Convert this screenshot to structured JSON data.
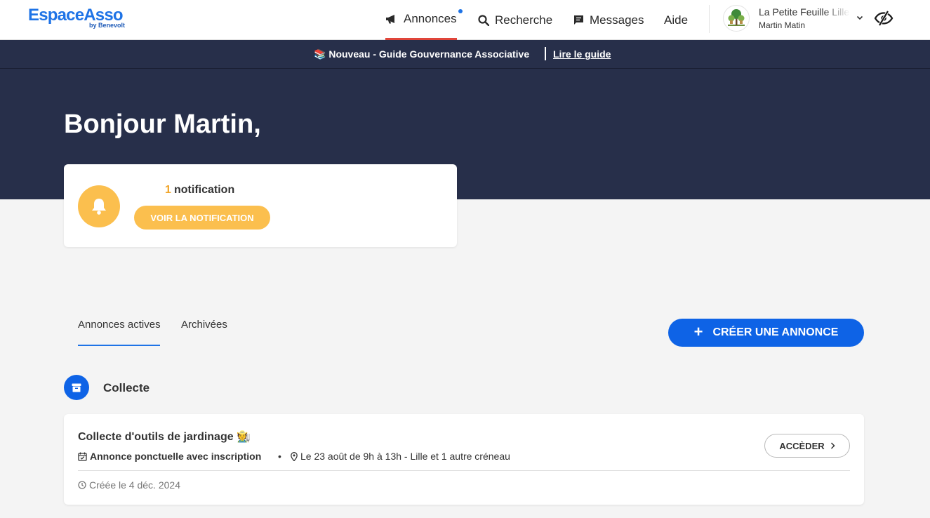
{
  "brand": {
    "name": "EspaceAsso",
    "byline": "by Benevolt",
    "color": "#1e73e6"
  },
  "nav": {
    "items": [
      {
        "label": "Annonces",
        "icon": "megaphone-icon",
        "active": true,
        "has_dot": true
      },
      {
        "label": "Recherche",
        "icon": "search-icon"
      },
      {
        "label": "Messages",
        "icon": "message-icon"
      },
      {
        "label": "Aide"
      }
    ]
  },
  "account": {
    "org_name": "La Petite Feuille Lille",
    "user_name": "Martin Matin",
    "avatar_icon": "tree-icon",
    "menu_icon": "chevron-down-icon",
    "visibility_icon": "eye-slash-icon"
  },
  "banner": {
    "emoji": "📚",
    "text": "Nouveau - Guide Gouvernance Associative",
    "link_label": "Lire le guide"
  },
  "hero": {
    "greeting": "Bonjour Martin,"
  },
  "notifications": {
    "count": "1",
    "label": "notification",
    "button_label": "VOIR LA NOTIFICATION",
    "icon": "bell-icon",
    "accent": "#fbbf4e"
  },
  "tabs": [
    {
      "label": "Annonces actives",
      "active": true
    },
    {
      "label": "Archivées",
      "active": false
    }
  ],
  "create_button": {
    "label": "CRÉER UNE ANNONCE",
    "icon": "plus-icon",
    "color": "#0e63e6"
  },
  "section": {
    "title": "Collecte",
    "icon": "archive-box-icon"
  },
  "listing": {
    "title": "Collecte d'outils de jardinage 🧑‍🌾",
    "type_label": "Annonce ponctuelle avec inscription",
    "type_icon": "calendar-check-icon",
    "bullet": "•",
    "place_label": "Le 23 août de 9h à 13h - Lille et 1 autre créneau",
    "place_icon": "map-pin-icon",
    "created_label": "Créée le 4 déc. 2024",
    "created_icon": "clock-icon",
    "access_label": "ACCÈDER",
    "access_icon": "chevron-right-icon"
  }
}
